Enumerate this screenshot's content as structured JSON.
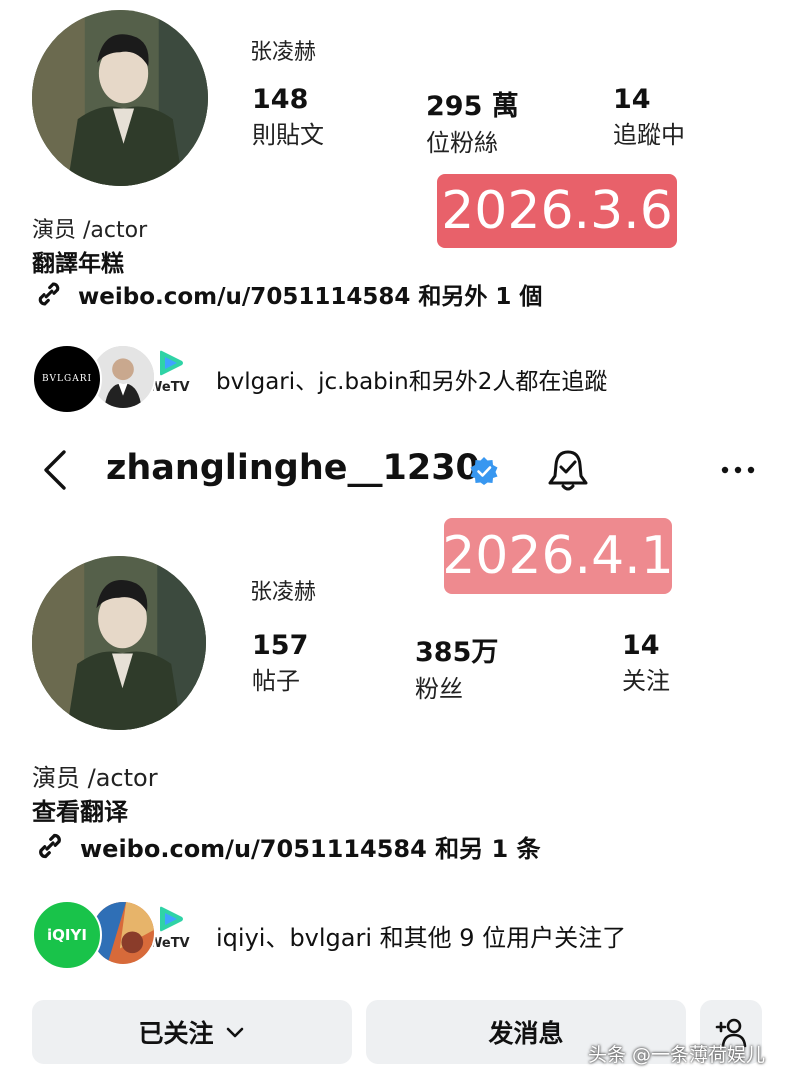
{
  "top_profile": {
    "display_name": "张凌赫",
    "stats": [
      {
        "value": "148",
        "label": "則貼文"
      },
      {
        "value": "295 萬",
        "label": "位粉絲"
      },
      {
        "value": "14",
        "label": "追蹤中"
      }
    ],
    "date_badge": "2026.3.6",
    "bio_line": "演员 /actor",
    "translate_label": "翻譯年糕",
    "link_text": "weibo.com/u/7051114584 和另外 1 個",
    "followers_text": "bvlgari、jc.babin和另外2人都在追蹤",
    "followers_logos": [
      {
        "icon": "bvlgari-logo",
        "text": "BVLGARI"
      },
      {
        "icon": "person-avatar",
        "text": ""
      },
      {
        "icon": "wetv-logo",
        "text": "WeTV"
      }
    ]
  },
  "header": {
    "back_icon": "back-arrow-icon",
    "username": "zhanglinghe__1230",
    "verified_icon": "verified-badge-icon",
    "bell_icon": "bell-icon",
    "more_icon": "more-icon",
    "verified_color": "#3897f0"
  },
  "bottom_profile": {
    "display_name": "张凌赫",
    "stats": [
      {
        "value": "157",
        "label": "帖子"
      },
      {
        "value": "385万",
        "label": "粉丝"
      },
      {
        "value": "14",
        "label": "关注"
      }
    ],
    "date_badge": "2026.4.1",
    "bio_line": "演员 /actor",
    "translate_label": "查看翻译",
    "link_text": "weibo.com/u/7051114584 和另 1 条",
    "followers_text": "iqiyi、bvlgari 和其他 9 位用户关注了",
    "followers_logos": [
      {
        "icon": "iqiyi-logo",
        "text": "iQIYI"
      },
      {
        "icon": "art-avatar",
        "text": ""
      },
      {
        "icon": "wetv-logo",
        "text": "WeTV"
      }
    ]
  },
  "actions": {
    "following_label": "已关注",
    "message_label": "发消息",
    "add_person_icon": "add-person-icon"
  },
  "watermark": "头条 @一条薄荷娱儿"
}
